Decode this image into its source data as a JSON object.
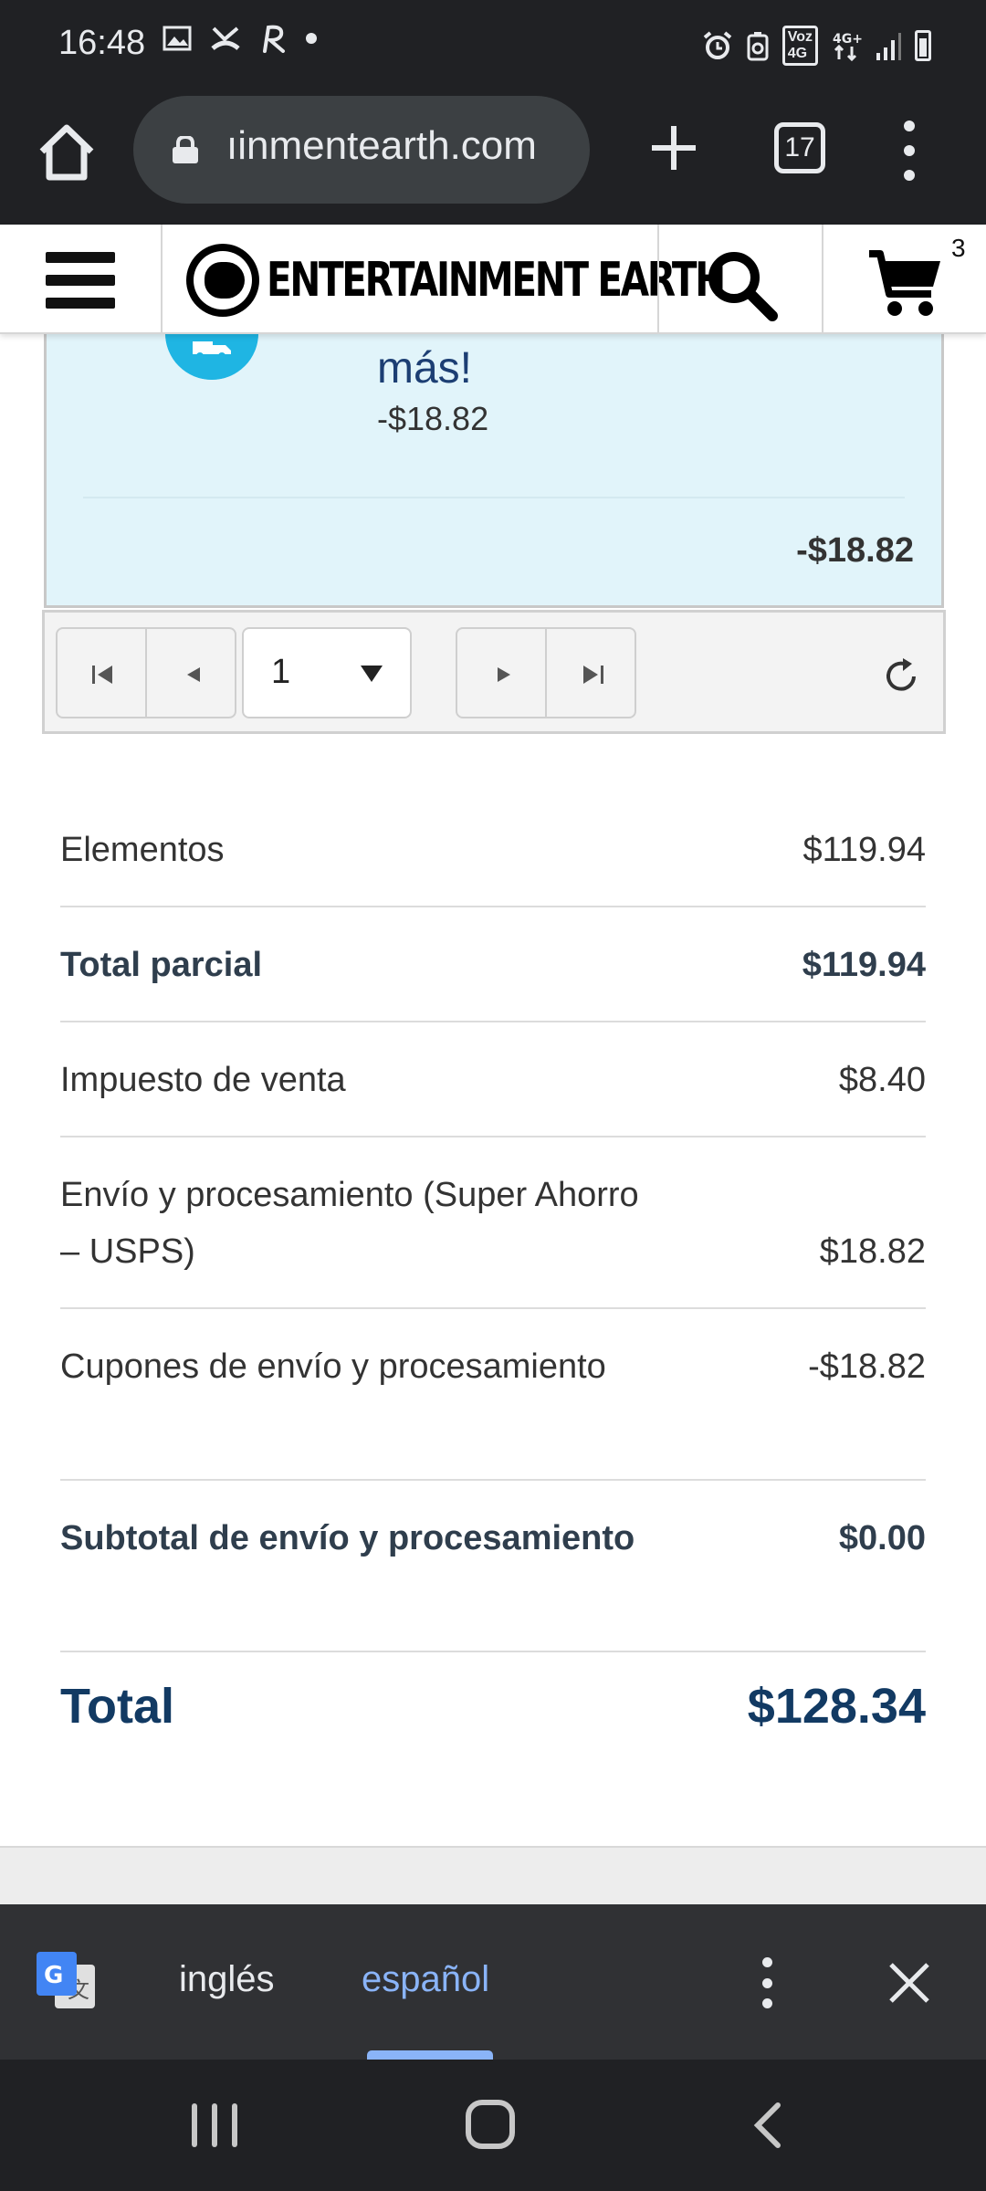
{
  "status_bar": {
    "time": "16:48",
    "left_icons": [
      "image-icon",
      "missed-call-icon",
      "r-app-icon",
      "dot-icon"
    ],
    "right_icons": [
      "alarm-icon",
      "data-saver-icon",
      "volte-icon",
      "network-4g-icon",
      "signal-icon",
      "battery-icon"
    ],
    "volte_label": "Voz\n4G",
    "network_label": "4G+"
  },
  "browser": {
    "url": "ıinmentearth.com",
    "tab_count": "17"
  },
  "site_header": {
    "logo_text": "ENTERTAINMENT EARTH",
    "cart_count": "3"
  },
  "coupon": {
    "title": "más!",
    "amount": "-$18.82",
    "total": "-$18.82"
  },
  "pager": {
    "current_page": "1"
  },
  "summary": {
    "rows": [
      {
        "label": "Elementos",
        "value": "$119.94"
      },
      {
        "label": "Total parcial",
        "value": "$119.94"
      },
      {
        "label": "Impuesto de venta",
        "value": "$8.40"
      },
      {
        "label": "Envío y procesamiento (Super Ahorro – USPS)",
        "value": "$18.82"
      },
      {
        "label": "Cupones de envío y procesamiento",
        "value": "-$18.82"
      },
      {
        "label": "Subtotal de envío y procesamiento",
        "value": "$0.00"
      }
    ],
    "total_label": "Total",
    "total_value": "$128.34"
  },
  "translate_bar": {
    "source_lang": "inglés",
    "target_lang": "español"
  },
  "colors": {
    "accent_blue": "#1fb5e3",
    "total_navy": "#123a63",
    "coupon_bg": "#e1f4fa",
    "selected_lang": "#8ab4f8"
  }
}
